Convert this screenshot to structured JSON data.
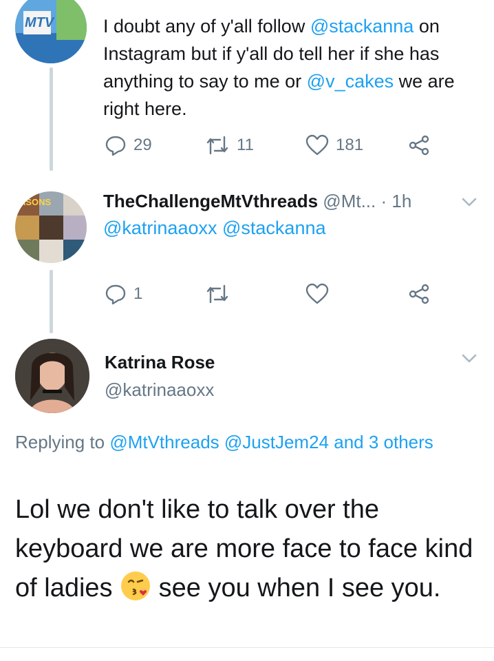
{
  "tweet1": {
    "avatar_label": "MTV",
    "text_parts": [
      {
        "t": "I doubt any of y'all follow ",
        "m": false
      },
      {
        "t": "@stackanna",
        "m": true
      },
      {
        "t": " on Instagram but if y'all do tell her if she has anything to say to me or ",
        "m": false
      },
      {
        "t": "@v_cakes",
        "m": true
      },
      {
        "t": " we are right here.",
        "m": false
      }
    ],
    "reply_count": "29",
    "retweet_count": "11",
    "like_count": "181"
  },
  "tweet2": {
    "avatar_label": "ASONS",
    "display_name": "TheChallengeMtVthreads",
    "handle": "@Mt...",
    "time": "· 1h",
    "mention1": "@katrinaaoxx",
    "mention2": "@stackanna",
    "reply_count": "1"
  },
  "tweet3": {
    "display_name": "Katrina Rose",
    "handle": "@katrinaaoxx",
    "replying_prefix": "Replying to ",
    "replying_to1": "@MtVthreads",
    "replying_to2": "@JustJem24",
    "replying_to3": "and 3 others",
    "text_before_emoji": "Lol we don't like to talk over the keyboard we are more face to face kind of ladies ",
    "text_after_emoji": " see you when I see you."
  },
  "colors": {
    "accent": "#1da1f2",
    "muted": "#657786",
    "thread_line": "#ccd6dd"
  },
  "icons": [
    "reply-icon",
    "retweet-icon",
    "like-icon",
    "share-icon",
    "chevron-down-icon",
    "kissing-face-emoji"
  ]
}
